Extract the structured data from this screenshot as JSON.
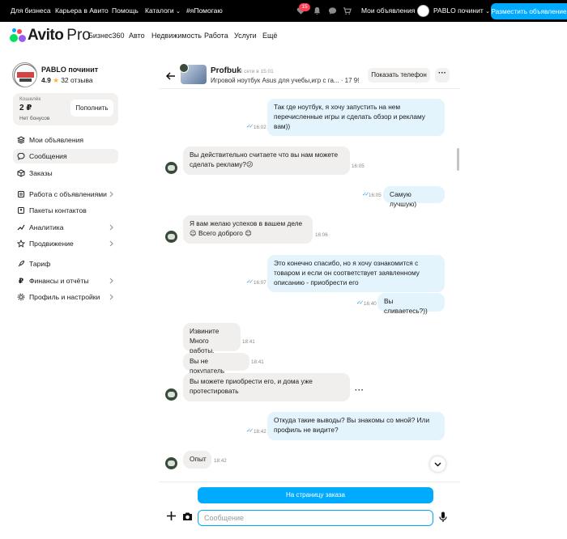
{
  "topbar": {
    "links": [
      "Для бизнеса",
      "Карьера в Авито",
      "Помощь",
      "Каталоги",
      "#яПомогаю"
    ],
    "notifications_count": "15",
    "my_ads": "Мои объявления",
    "username": "PABLO починит",
    "post_ad": "Разместить объявление"
  },
  "header": {
    "logo": "Avito",
    "logo_suffix": "Pro",
    "nav": [
      "Бизнес360",
      "Авто",
      "Недвижимость",
      "Работа",
      "Услуги",
      "Ещё"
    ]
  },
  "sidebar": {
    "profile_name": "PABLO починит",
    "rating": "4.9",
    "reviews": "32 отзыва",
    "wallet_label": "Кошелёк",
    "wallet_value": "2 ₽",
    "bonuses": "Нет бонусов",
    "topup": "Пополнить",
    "items": [
      {
        "label": "Мои объявления",
        "icon": "layers-icon"
      },
      {
        "label": "Сообщения",
        "icon": "chat-icon"
      },
      {
        "label": "Заказы",
        "icon": "package-icon"
      },
      {
        "label": "Работа с объявлениями",
        "icon": "list-icon"
      },
      {
        "label": "Пакеты контактов",
        "icon": "contacts-icon"
      },
      {
        "label": "Аналитика",
        "icon": "chart-icon"
      },
      {
        "label": "Продвижение",
        "icon": "star-icon"
      },
      {
        "label": "Тариф",
        "icon": "rocket-icon"
      },
      {
        "label": "Финансы и отчёты",
        "icon": "ruble-icon"
      },
      {
        "label": "Профиль и настройки",
        "icon": "gear-icon"
      }
    ]
  },
  "chat": {
    "name": "Profbuk",
    "last_seen": "В сети в 15:01",
    "item": "Игровой ноутбук Asus для учебы,игр с га... · 17 990 ₽",
    "show_phone": "Показать телефон",
    "messages": [
      {
        "text": "Так где ноутбук, я хочу запустить на нем перечисленные игры и сделать обзор и рекламу вам))",
        "time": "16:02"
      },
      {
        "text": "Вы действительно считаете что вы нам можете сделать рекламу?😕",
        "time": "16:05"
      },
      {
        "text": "Самую лучшую)",
        "time": "16:05"
      },
      {
        "text": "Я вам желаю успехов в вашем деле 😉 Всего доброго 😊",
        "time": "16:06"
      },
      {
        "text": "Это конечно спасибо, но я хочу ознакомится с товаром и если он соответствует заявленному описанию - приобрести его",
        "time": "16:07"
      },
      {
        "text": "Вы сливаетесь?))",
        "time": "16:40"
      },
      {
        "text": "Извините Много работы.",
        "time": "18:41"
      },
      {
        "text": "Вы не покупатель",
        "time": "18:41"
      },
      {
        "text": "Вы можете приобрести его,  и дома уже протестировать",
        "time": ""
      },
      {
        "text": "Откуда такие выводы? Вы знакомы со мной? Или профиль не видите?",
        "time": "18:42"
      },
      {
        "text": "Опыт",
        "time": "18:42"
      }
    ],
    "order_button": "На страницу заказа",
    "input_placeholder": "Сообщение"
  },
  "colors": {
    "accent": "#00aaff",
    "outgoing": "#e3f4fd",
    "incoming": "#f0efee"
  }
}
